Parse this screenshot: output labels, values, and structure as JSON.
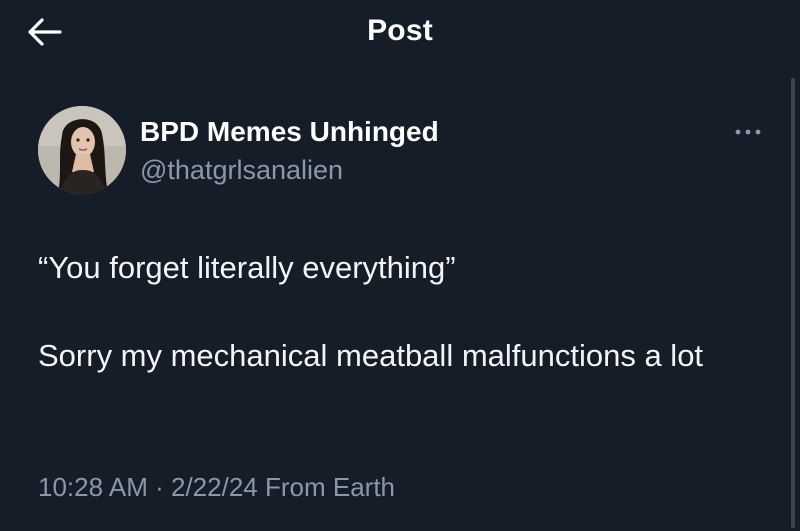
{
  "header": {
    "back_icon": "arrow-left-icon",
    "title": "Post"
  },
  "author": {
    "name": "BPD Memes Unhinged",
    "handle": "@thatgrlsanalien",
    "avatar_icon": "profile-photo"
  },
  "post": {
    "text": "“You forget literally everything”\n\nSorry my mechanical meatball malfunctions a lot",
    "time": "10:28 AM",
    "separator": "·",
    "date": "2/22/24",
    "source": "From Earth",
    "more_icon": "more-options-icon"
  },
  "colors": {
    "background": "#151d28",
    "primary_text": "#ffffff",
    "secondary_text": "#8b98a5"
  }
}
